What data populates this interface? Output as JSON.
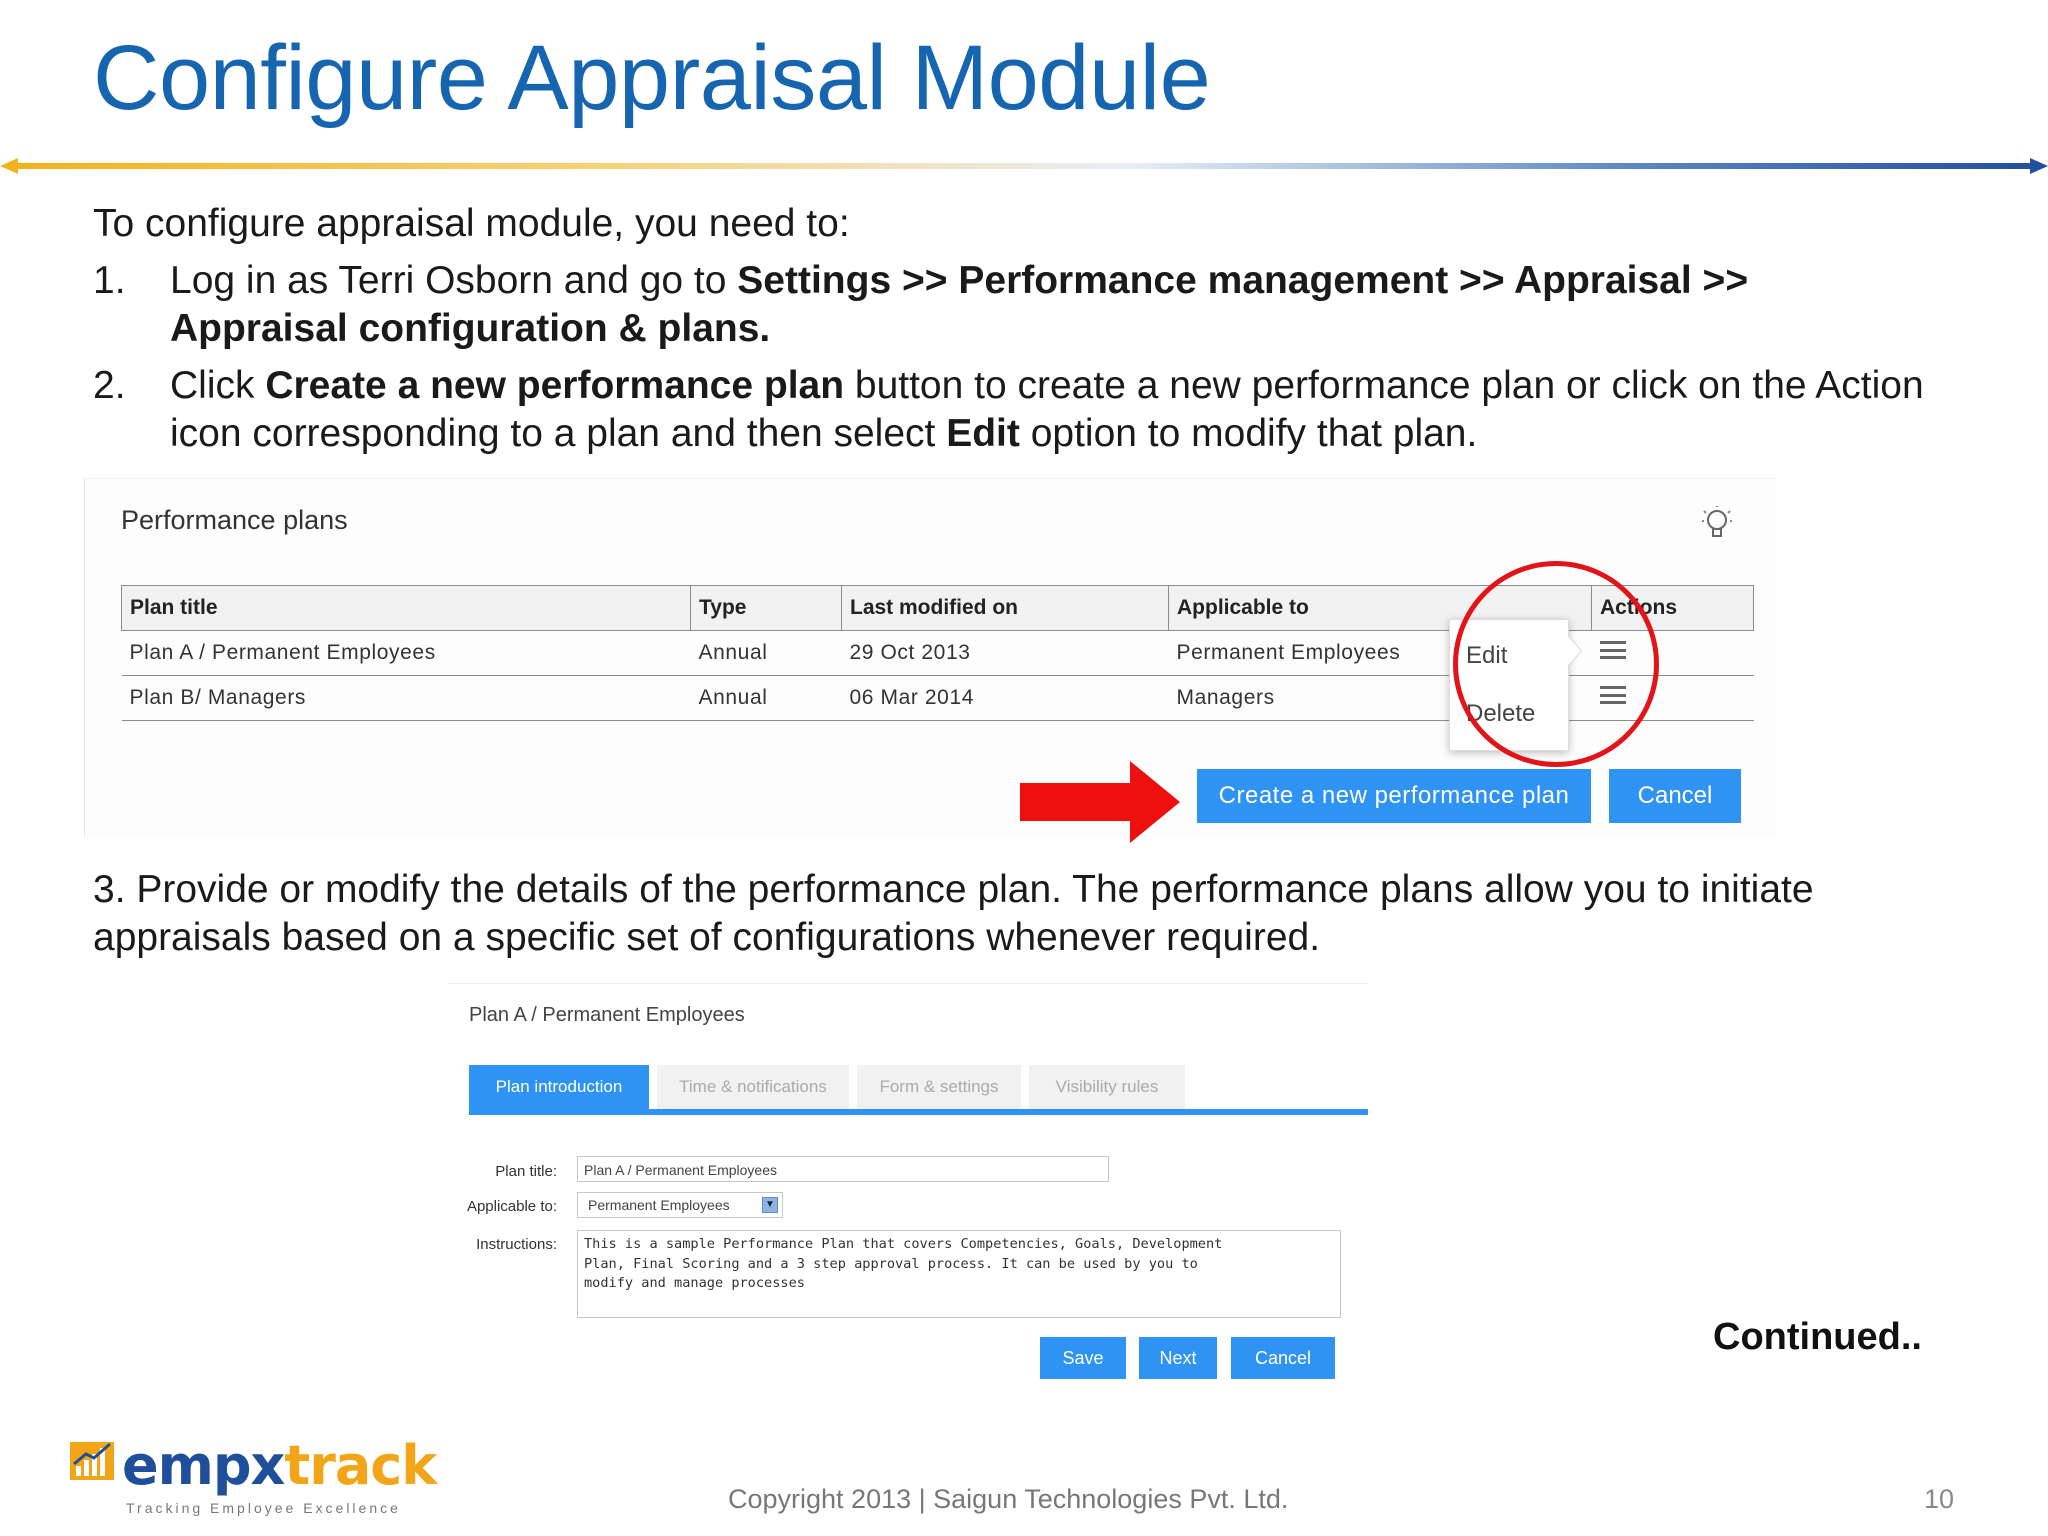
{
  "slide": {
    "title": "Configure Appraisal Module",
    "intro": "To configure appraisal module, you need to:",
    "steps": [
      {
        "num": "1.",
        "line1_plain": "Log in as Terri Osborn and go to ",
        "line1_bold": "Settings >> Performance management >> Appraisal >>",
        "line2_bold": "Appraisal configuration & plans."
      },
      {
        "num": "2.",
        "line1_plain_a": "Click ",
        "line1_bold": "Create a new performance plan",
        "line1_plain_b": " button to create a new performance plan or click on the Action",
        "line2_plain_a": "icon corresponding to a plan and then select ",
        "line2_bold": "Edit",
        "line2_plain_b": " option to modify that plan."
      }
    ],
    "step3_line1": "3. Provide or modify the details of the performance plan. The performance plans allow you to initiate",
    "step3_line2": "appraisals based on a specific set of configurations whenever required.",
    "continued": "Continued..",
    "copyright": "Copyright 2013 | Saigun Technologies Pvt. Ltd.",
    "page_number": "10",
    "logo": {
      "brand_a": "empx",
      "brand_b": "track",
      "tagline": "Tracking Employee Excellence"
    },
    "colors": {
      "title_blue": "#1565b0",
      "button_blue": "#2e93f2",
      "highlight_red": "#e2141a",
      "logo_blue": "#1f4e9a",
      "logo_orange": "#f2a516"
    }
  },
  "performance_plans": {
    "heading": "Performance plans",
    "help_icon": "lightbulb-icon",
    "columns": [
      "Plan title",
      "Type",
      "Last modified on",
      "Applicable to",
      "Actions"
    ],
    "rows": [
      {
        "plan_title": "Plan A / Permanent Employees",
        "type": "Annual",
        "last_modified": "29 Oct 2013",
        "applicable_to": "Permanent Employees"
      },
      {
        "plan_title": "Plan B/ Managers",
        "type": "Annual",
        "last_modified": "06 Mar 2014",
        "applicable_to": "Managers"
      }
    ],
    "action_menu": {
      "edit": "Edit",
      "delete": "Delete"
    },
    "create_button": "Create a new performance plan",
    "cancel_button": "Cancel"
  },
  "plan_form": {
    "heading": "Plan A / Permanent Employees",
    "tabs": [
      "Plan introduction",
      "Time & notifications",
      "Form & settings",
      "Visibility rules"
    ],
    "active_tab": "Plan introduction",
    "fields": {
      "plan_title_label": "Plan title:",
      "plan_title_value": "Plan A / Permanent Employees",
      "applicable_label": "Applicable to:",
      "applicable_value": "Permanent Employees",
      "instructions_label": "Instructions:",
      "instructions_value": "This is a sample Performance Plan that covers Competencies, Goals, Development\nPlan, Final Scoring and a 3 step approval process. It can be used by you to\nmodify and manage processes"
    },
    "buttons": {
      "save": "Save",
      "next": "Next",
      "cancel": "Cancel"
    }
  }
}
